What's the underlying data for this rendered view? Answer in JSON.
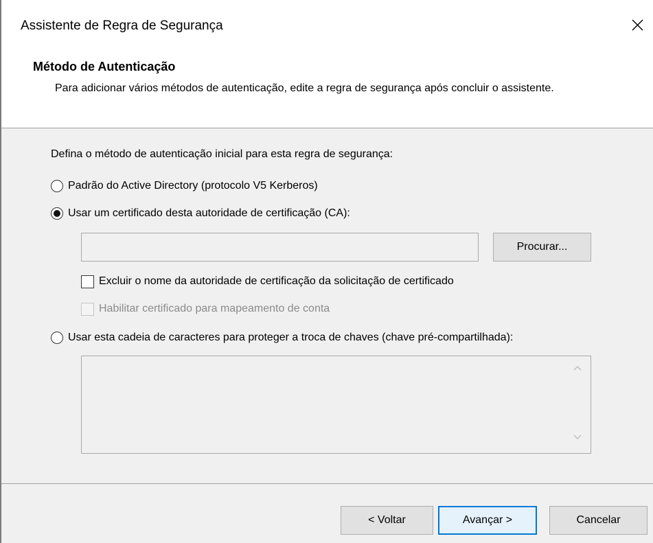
{
  "window": {
    "title": "Assistente de Regra de Segurança",
    "close_icon": "close-icon"
  },
  "header": {
    "title": "Método de Autenticação",
    "description": "Para adicionar vários métodos de autenticação, edite a regra de segurança após concluir o assistente."
  },
  "body": {
    "intro": "Defina o método de autenticação inicial para esta regra de segurança:",
    "options": {
      "ad_default": {
        "label": "Padrão do Active Directory (protocolo V5 Kerberos)",
        "selected": false
      },
      "certificate_ca": {
        "label": "Usar um certificado desta autoridade de certificação (CA):",
        "selected": true
      },
      "preshared_key": {
        "label": "Usar esta cadeia de caracteres para proteger a troca de chaves (chave pré-compartilhada):",
        "selected": false
      }
    },
    "ca_field": {
      "value": ""
    },
    "browse_label": "Procurar...",
    "checkboxes": {
      "exclude_ca_name": {
        "label": "Excluir o nome da autoridade de certificação da solicitação de certificado",
        "checked": false,
        "enabled": true
      },
      "enable_account_mapping": {
        "label": "Habilitar certificado para mapeamento de conta",
        "checked": false,
        "enabled": false
      }
    },
    "psk_field": {
      "value": ""
    }
  },
  "footer": {
    "back_label": "< Voltar",
    "next_label": "Avançar >",
    "cancel_label": "Cancelar"
  },
  "colors": {
    "default_button_border": "#0078d7",
    "default_button_fill": "#e5f1fb",
    "disabled_text": "#8b8b8b"
  }
}
